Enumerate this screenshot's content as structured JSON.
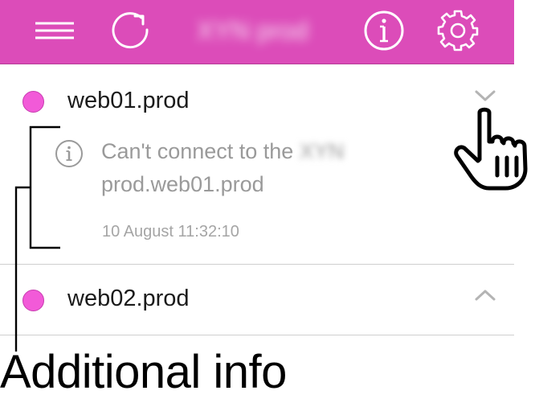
{
  "header": {
    "title": "XYN prod",
    "menu_icon": "hamburger-icon",
    "refresh_icon": "refresh-icon",
    "info_icon": "info-icon",
    "settings_icon": "gear-icon",
    "background": "#dc4cb9"
  },
  "servers": [
    {
      "name": "web01.prod",
      "status_color": "#f25ad8",
      "expanded": true,
      "detail": {
        "message_prefix": "Can't connect to the ",
        "message_blurred": "XYN",
        "message_line2": "prod.web01.prod",
        "timestamp": "10 August 11:32:10"
      }
    },
    {
      "name": "web02.prod",
      "status_color": "#f25ad8",
      "expanded": false
    }
  ],
  "annotation": {
    "label": "Additional info"
  }
}
